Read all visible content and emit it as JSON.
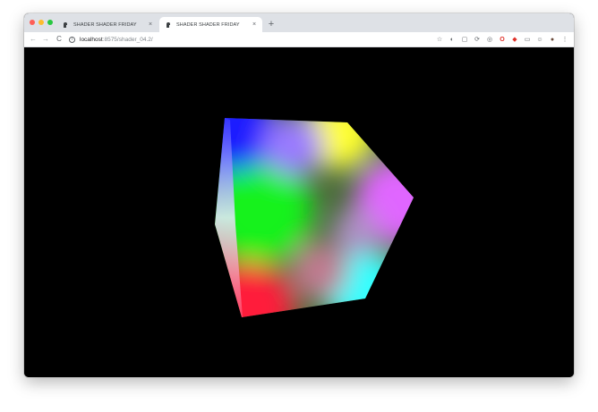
{
  "browser": {
    "tabs": [
      {
        "title": "SHADER SHADER FRIDAY",
        "active": false,
        "close_glyph": "×"
      },
      {
        "title": "SHADER SHADER FRIDAY",
        "active": true,
        "close_glyph": "×"
      }
    ],
    "new_tab_glyph": "+",
    "url_host": "localhost",
    "url_path": ":8575/shader_04.2/",
    "back_glyph": "←",
    "forward_glyph": "→",
    "reload_glyph": "C",
    "info_glyph": "i",
    "extensions": [
      {
        "name": "star-icon",
        "glyph": "☆"
      },
      {
        "name": "extension-1-icon",
        "glyph": "◐"
      },
      {
        "name": "extension-2-icon",
        "glyph": "▢"
      },
      {
        "name": "extension-3-icon",
        "glyph": "⟳"
      },
      {
        "name": "extension-4-icon",
        "glyph": "◎"
      },
      {
        "name": "opera-icon",
        "glyph": "O"
      },
      {
        "name": "extension-5-icon",
        "glyph": "◆"
      },
      {
        "name": "extension-6-icon",
        "glyph": "▭"
      },
      {
        "name": "extension-7-icon",
        "glyph": "☺"
      },
      {
        "name": "profile-avatar-icon",
        "glyph": "●"
      },
      {
        "name": "menu-icon",
        "glyph": "⋮"
      }
    ]
  },
  "colors": {
    "background": "#000000",
    "tabstrip": "#dee1e6",
    "cube_red": "#ff1a3a",
    "cube_green": "#19f21a",
    "cube_blue": "#1a1aff",
    "cube_yellow": "#ffff33",
    "cube_magenta": "#e066ff",
    "cube_cyan": "#33ffff",
    "cube_white": "#ffffff"
  }
}
